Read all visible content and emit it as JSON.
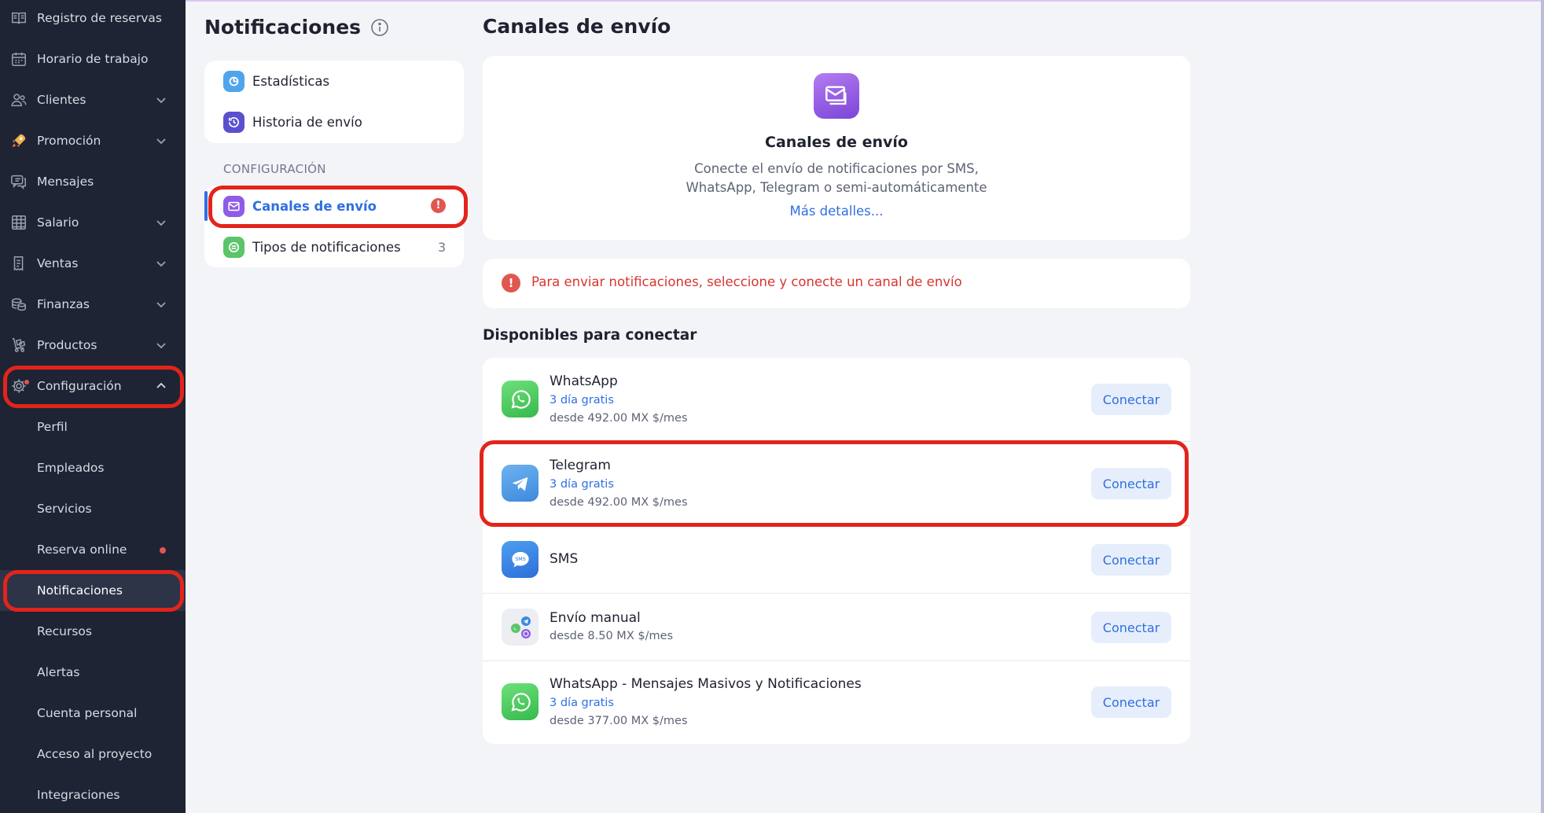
{
  "sidebar": {
    "items": [
      {
        "label": "Registro de reservas",
        "icon": "book-icon",
        "chevron": false
      },
      {
        "label": "Horario de trabajo",
        "icon": "calendar-icon",
        "chevron": false
      },
      {
        "label": "Clientes",
        "icon": "users-icon",
        "chevron": true
      },
      {
        "label": "Promoción",
        "icon": "rocket-icon",
        "chevron": true
      },
      {
        "label": "Mensajes",
        "icon": "chat-icon",
        "chevron": false
      },
      {
        "label": "Salario",
        "icon": "spreadsheet-icon",
        "chevron": true
      },
      {
        "label": "Ventas",
        "icon": "receipt-icon",
        "chevron": true
      },
      {
        "label": "Finanzas",
        "icon": "coins-icon",
        "chevron": true
      },
      {
        "label": "Productos",
        "icon": "cart-icon",
        "chevron": true
      },
      {
        "label": "Configuración",
        "icon": "gear-icon",
        "chevron": true,
        "expanded": true
      }
    ],
    "sub_items": [
      {
        "label": "Perfil"
      },
      {
        "label": "Empleados"
      },
      {
        "label": "Servicios"
      },
      {
        "label": "Reserva online",
        "dot": true
      },
      {
        "label": "Notificaciones",
        "active": true
      },
      {
        "label": "Recursos"
      },
      {
        "label": "Alertas"
      },
      {
        "label": "Cuenta personal"
      },
      {
        "label": "Acceso al proyecto"
      },
      {
        "label": "Integraciones"
      }
    ]
  },
  "middle": {
    "title": "Notificaciones",
    "menu_top": [
      {
        "label": "Estadísticas",
        "icon": "stats-icon"
      },
      {
        "label": "Historia de envío",
        "icon": "history-icon"
      }
    ],
    "section_caption": "CONFIGURACIÓN",
    "menu_config": [
      {
        "label": "Canales de envío",
        "icon": "envelope-icon",
        "active": true,
        "warning": "!"
      },
      {
        "label": "Tipos de notificaciones",
        "icon": "list-icon",
        "count": "3"
      }
    ]
  },
  "main": {
    "title": "Canales de envío",
    "hero": {
      "title": "Canales de envío",
      "description_line1": "Conecte el envío de notificaciones por SMS,",
      "description_line2": "WhatsApp, Telegram o semi-automáticamente",
      "link": "Más detalles..."
    },
    "alert": {
      "icon": "!",
      "text": "Para enviar notificaciones, seleccione y conecte un canal de envío"
    },
    "available_title": "Disponibles para conectar",
    "channels": [
      {
        "name": "WhatsApp",
        "trial": "3 día gratis",
        "price": "desde 492.00 MX $/mes",
        "button": "Conectar",
        "icon": "whatsapp-icon"
      },
      {
        "name": "Telegram",
        "trial": "3 día gratis",
        "price": "desde 492.00 MX $/mes",
        "button": "Conectar",
        "icon": "telegram-icon"
      },
      {
        "name": "SMS",
        "button": "Conectar",
        "icon": "sms-icon",
        "icon_text": "SMS"
      },
      {
        "name": "Envío manual",
        "price": "desde 8.50 MX $/mes",
        "button": "Conectar",
        "icon": "messengers-icon"
      },
      {
        "name": "WhatsApp - Mensajes Masivos y Notificaciones",
        "trial": "3 día gratis",
        "price": "desde 377.00 MX $/mes",
        "button": "Conectar",
        "icon": "whatsapp-icon"
      }
    ]
  },
  "colors": {
    "sidebar_bg": "#1e2433",
    "accent_blue": "#2f6fe0",
    "alert_red": "#d8352f",
    "annotation_red": "#e3241b",
    "page_bg": "#f3f4f8"
  }
}
